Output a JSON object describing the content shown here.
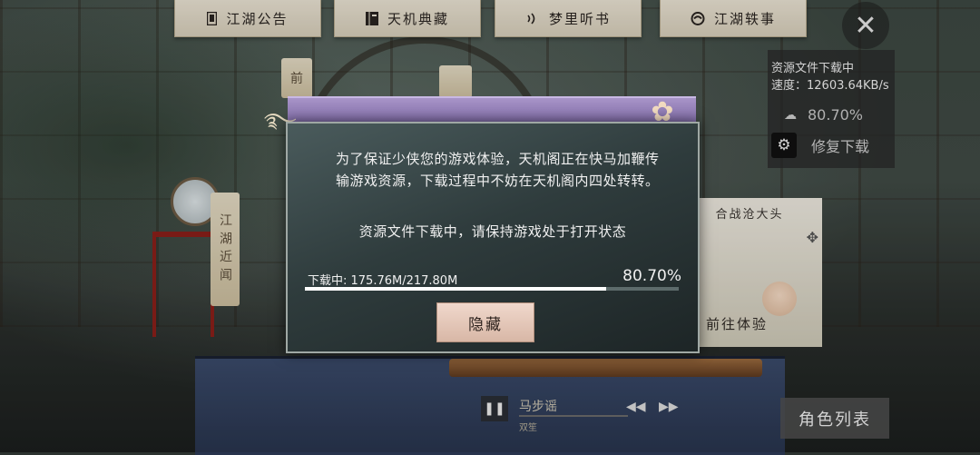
{
  "top_tabs": [
    {
      "label": "江湖公告",
      "icon": "notice-icon"
    },
    {
      "label": "天机典藏",
      "icon": "book-icon"
    },
    {
      "label": "梦里听书",
      "icon": "audio-icon"
    },
    {
      "label": "江湖轶事",
      "icon": "story-icon"
    }
  ],
  "close": {
    "icon": "close-icon",
    "glyph": "✕"
  },
  "download_panel": {
    "title": "资源文件下载中",
    "speed": "速度：12603.64KB/s",
    "percent": "80.70%",
    "repair_label": "修复下载"
  },
  "scene": {
    "scroll_left": "江湖近闻",
    "scroll_top": "前",
    "banner_title": "合战沧大头",
    "banner_action": "前往体验"
  },
  "music": {
    "song": "马步谣",
    "artist": "双笙",
    "pause_glyph": "❚❚",
    "prev_glyph": "◀◀",
    "next_glyph": "▶▶"
  },
  "role_list_label": "角色列表",
  "dialog": {
    "message": "为了保证少侠您的游戏体验，天机阁正在快马加鞭传输游戏资源，下载过程中不妨在天机阁内四处转转。",
    "keep_open": "资源文件下载中，请保持游戏处于打开状态",
    "download_label": "下载中: 175.76M/217.80M",
    "percent_label": "80.70%",
    "progress_fraction": 0.807,
    "hide_label": "隐藏"
  },
  "colors": {
    "header_purple": "#8c78b2",
    "dialog_bg": "#2f3c3d",
    "button_pink": "#e4c6b6"
  }
}
